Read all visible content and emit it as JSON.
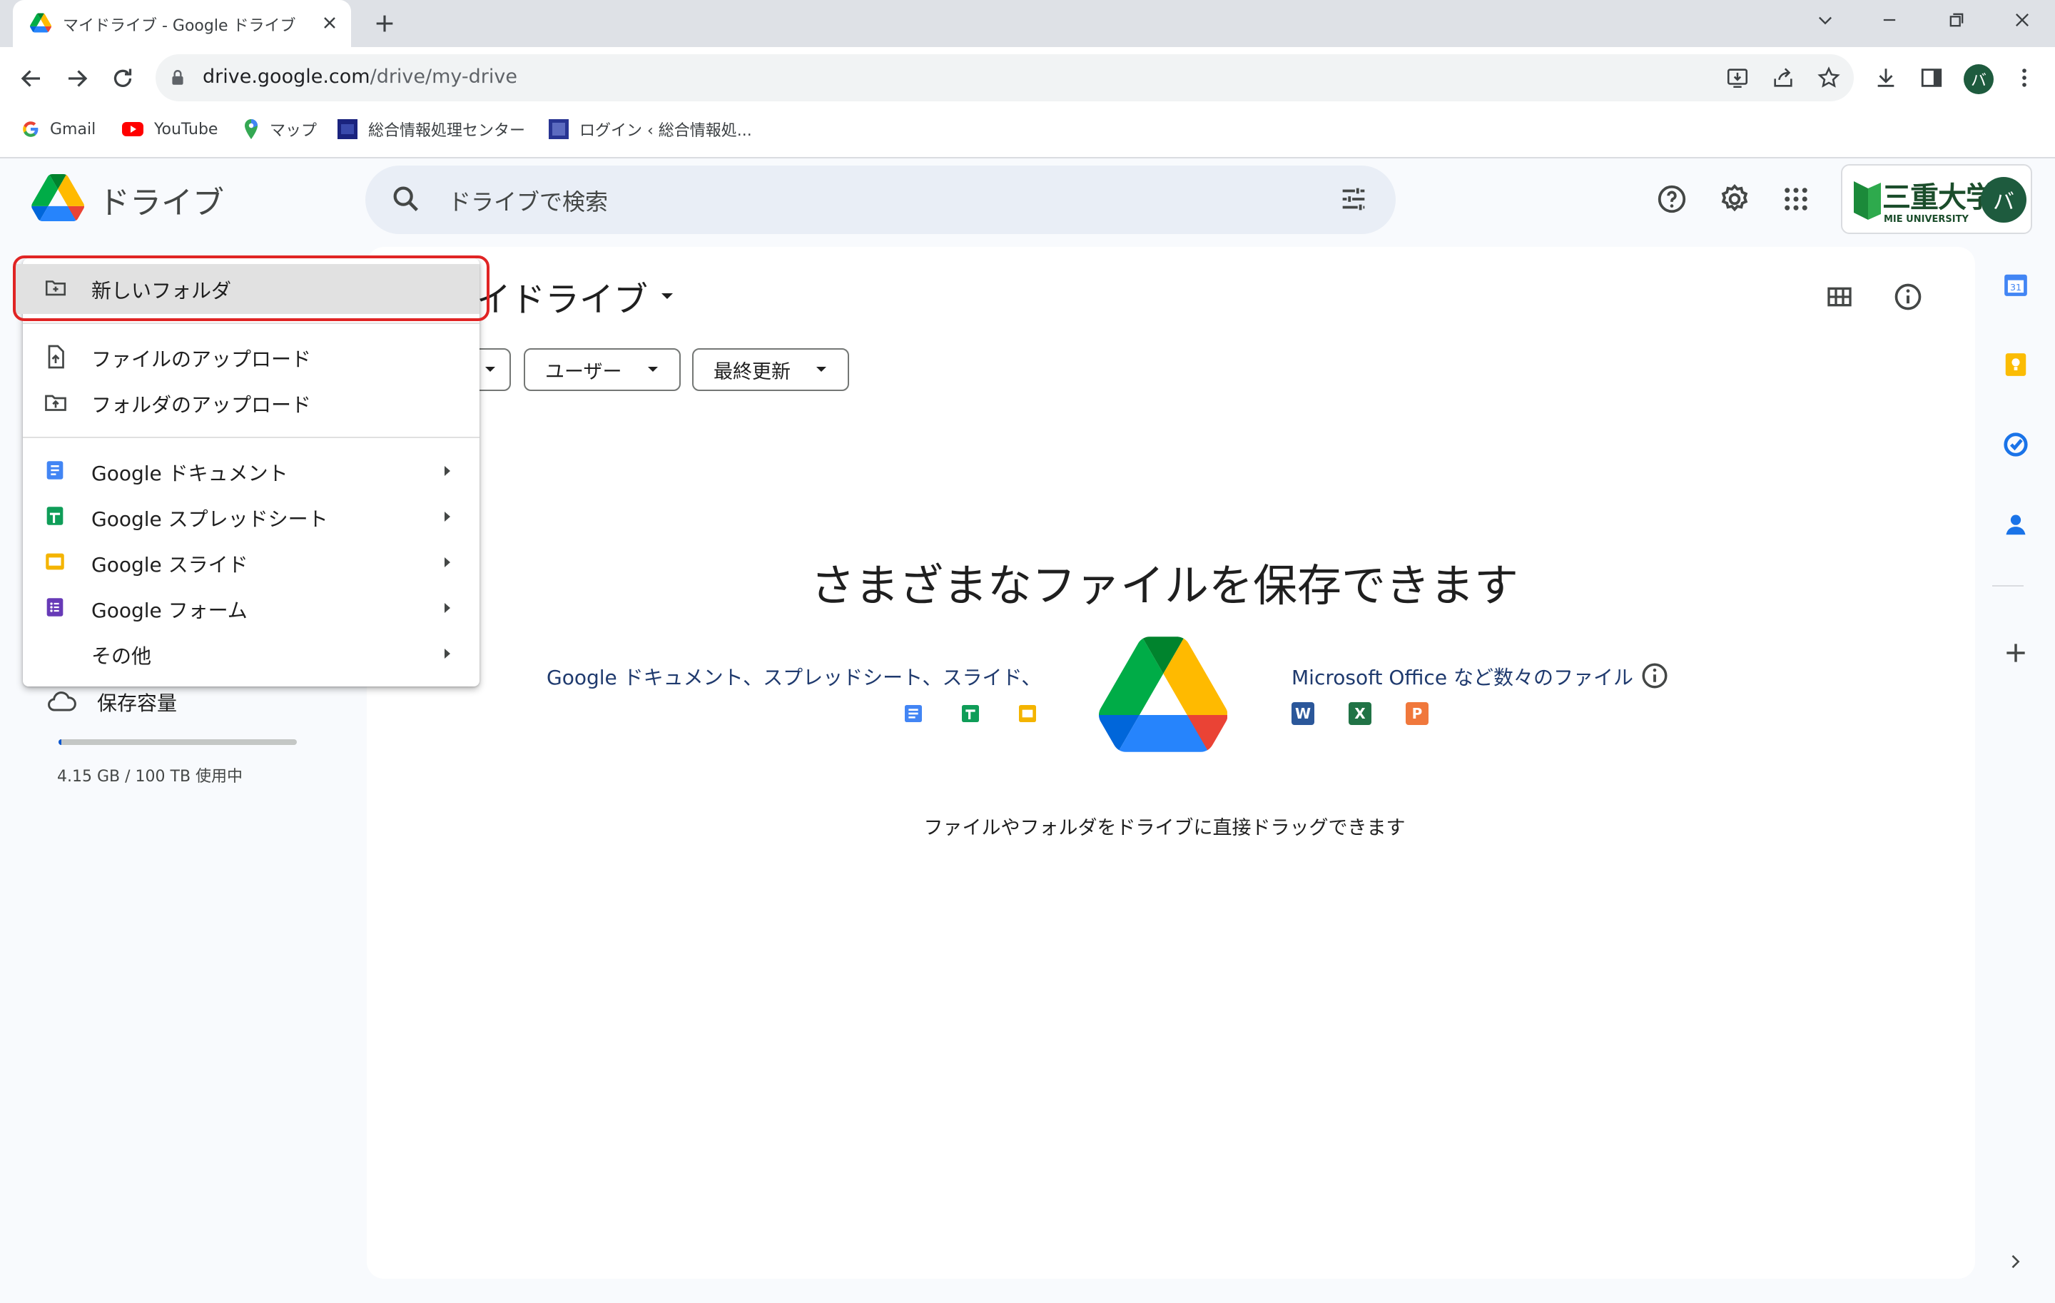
{
  "browser": {
    "tab_title": "マイドライブ - Google ドライブ",
    "url_host": "drive.google.com",
    "url_path": "/drive/my-drive",
    "profile_initial": "バ",
    "bookmarks": [
      {
        "label": "Gmail"
      },
      {
        "label": "YouTube"
      },
      {
        "label": "マップ"
      },
      {
        "label": "総合情報処理センター"
      },
      {
        "label": "ログイン ‹ 総合情報処..."
      }
    ]
  },
  "drive": {
    "app_name": "ドライブ",
    "search_placeholder": "ドライブで検索",
    "org_name": "三重大学",
    "org_sub": "MIE UNIVERSITY",
    "avatar_initial": "バ",
    "page_title": "マイドライブ",
    "filters": [
      "ユーザー",
      "最終更新"
    ],
    "storage_label": "保存容量",
    "storage_used": "4.15 GB / 100 TB 使用中",
    "storage_fraction": 4.15e-05,
    "empty_title": "さまざまなファイルを保存できます",
    "empty_left": "Google ドキュメント、スプレッドシート、スライド、",
    "empty_right": "Microsoft Office など数々のファイル",
    "empty_hint": "ファイルやフォルダをドライブに直接ドラッグできます",
    "office_letters": [
      "W",
      "X",
      "P"
    ]
  },
  "menu": {
    "new_folder": "新しいフォルダ",
    "upload_file": "ファイルのアップロード",
    "upload_folder": "フォルダのアップロード",
    "docs": "Google ドキュメント",
    "sheets": "Google スプレッドシート",
    "slides": "Google スライド",
    "forms": "Google フォーム",
    "more": "その他"
  },
  "colors": {
    "blue": "#4285f4",
    "green": "#34a853",
    "yellow": "#fbbc04",
    "red": "#ea4335",
    "purple": "#673ab7",
    "highlight": "#e02424"
  }
}
